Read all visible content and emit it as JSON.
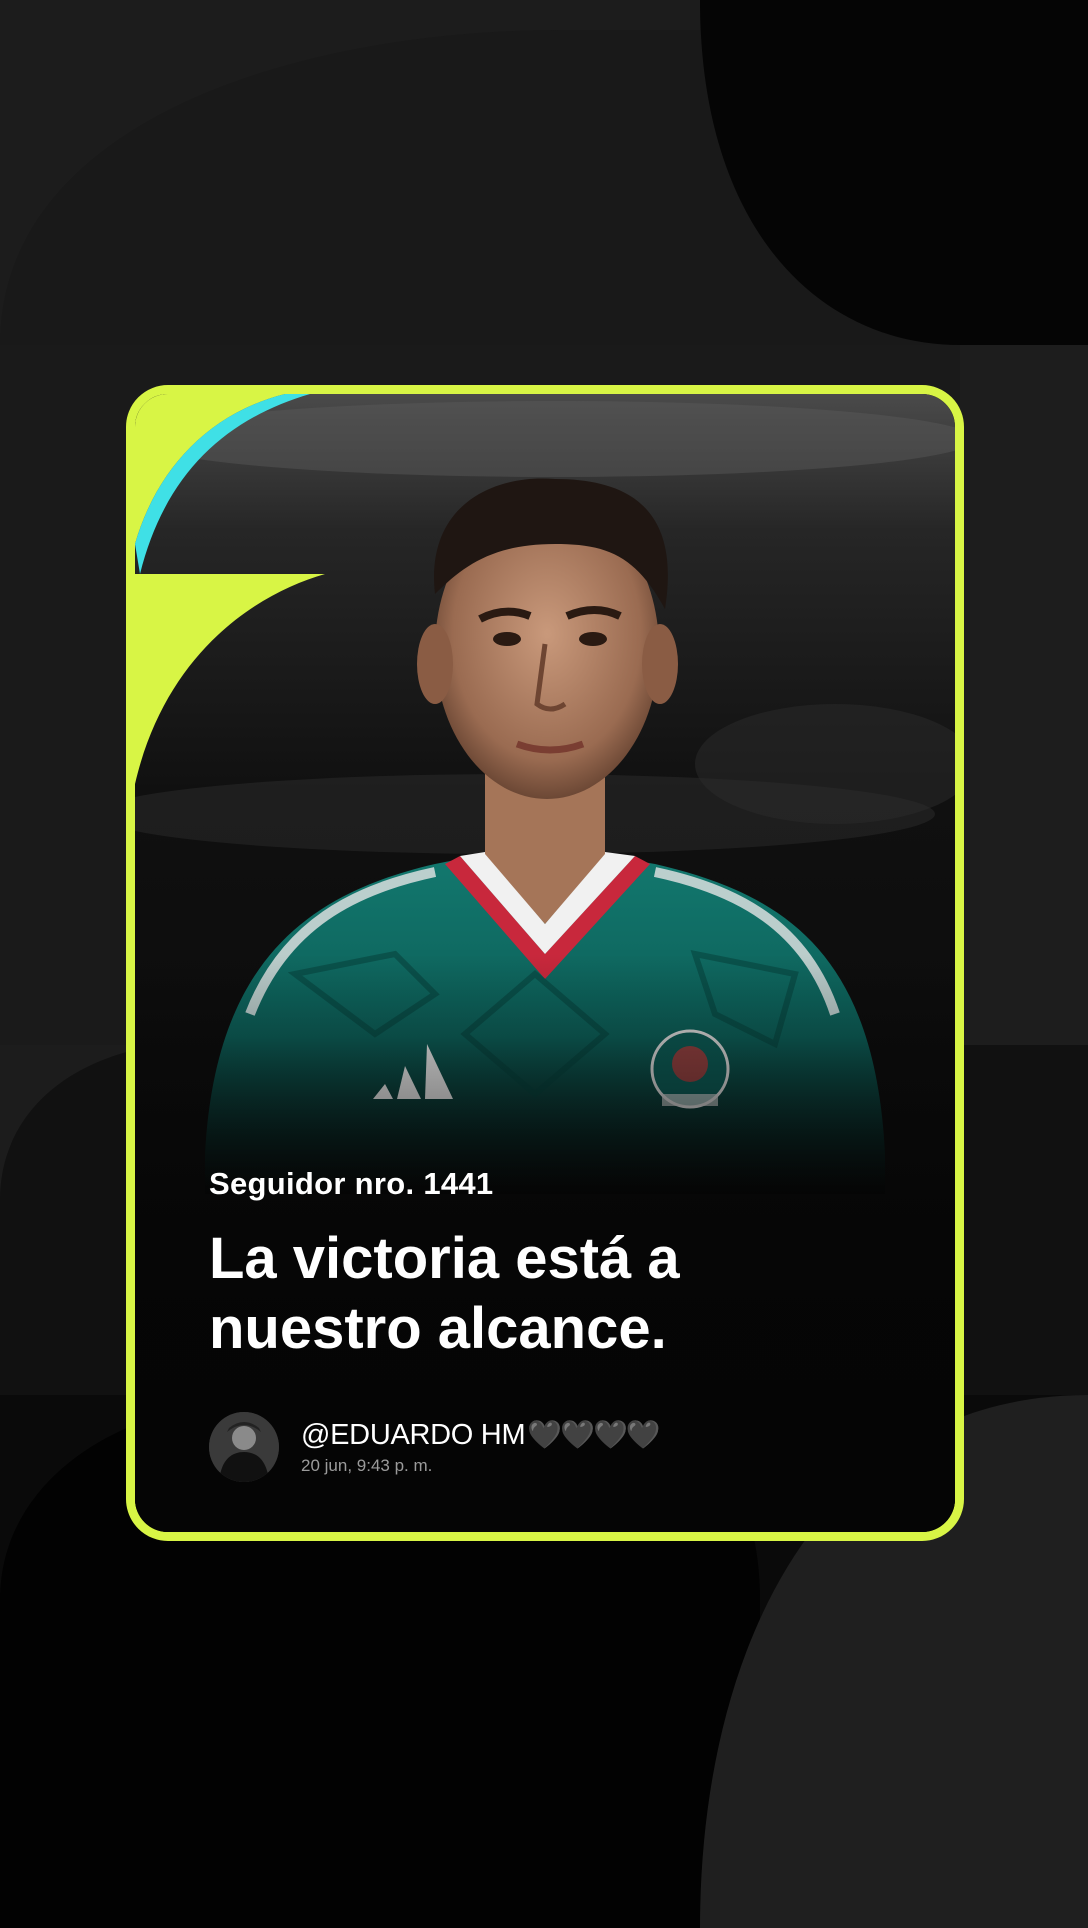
{
  "card": {
    "follower_label": "Seguidor nro. 1441",
    "quote": "La victoria está a nuestro alcance.",
    "author": {
      "handle": "@EDUARDO HM",
      "hearts": "🖤🖤🖤🖤",
      "date": "20 jun, 9:43 p. m."
    },
    "photo_description_icon": "player-portrait-photo",
    "avatar_icon": "profile-photo-icon"
  },
  "colors": {
    "frame": "#d8f545",
    "accent_cyan": "#3fe0e6",
    "background": "#141414",
    "card_bg": "#050505",
    "jersey": "#0c6b63",
    "collar_red": "#c8283c"
  }
}
